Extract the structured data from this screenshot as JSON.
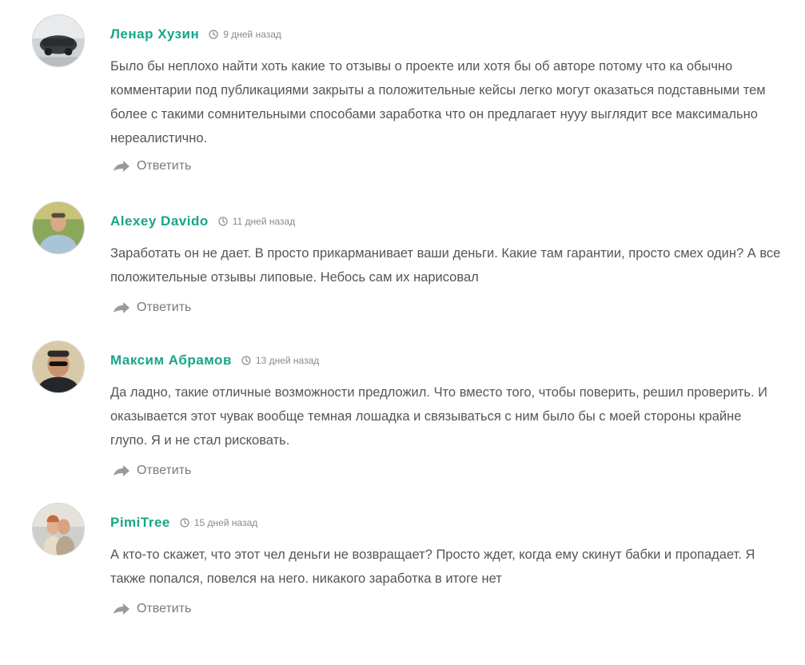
{
  "comments": [
    {
      "author": "Ленар Хузин",
      "date": "9 дней назад",
      "text": "Было бы неплохо найти хоть какие то отзывы о проекте или хотя бы об авторе потому что ка обычно комментарии под публикациями закрыты а положительные кейсы легко могут оказаться подставными тем более с такими сомнительными способами заработка что он предлагает нууу выглядит все максимально нереалистично.",
      "reply_label": "Ответить"
    },
    {
      "author": "Alexey Davido",
      "date": "11 дней назад",
      "text": "Заработать он не дает. В просто прикарманивает ваши деньги. Какие там гарантии, просто смех один? А все положительные отзывы липовые. Небось сам их нарисовал",
      "reply_label": "Ответить"
    },
    {
      "author": "Максим Абрамов",
      "date": "13 дней назад",
      "text": "Да ладно, такие отличные возможности предложил. Что вместо того, чтобы поверить, решил проверить. И оказывается этот чувак вообще темная лошадка и связываться с ним было бы с моей стороны крайне глупо. Я и не стал рисковать.",
      "reply_label": "Ответить"
    },
    {
      "author": "PimiTree",
      "date": "15 дней назад",
      "text": "А кто-то скажет, что этот чел деньги не возвращает? Просто ждет, когда ему скинут бабки и пропадает. Я также попался, повелся на него. никакого заработка в итоге нет",
      "reply_label": "Ответить"
    }
  ],
  "icons": {
    "clock": "clock-icon",
    "reply": "reply-arrow-icon"
  },
  "colors": {
    "author": "#17a589",
    "text": "#555555",
    "date": "#8a8a8a",
    "reply": "#7a7a7a",
    "reply_icon": "#9a9a9a"
  }
}
